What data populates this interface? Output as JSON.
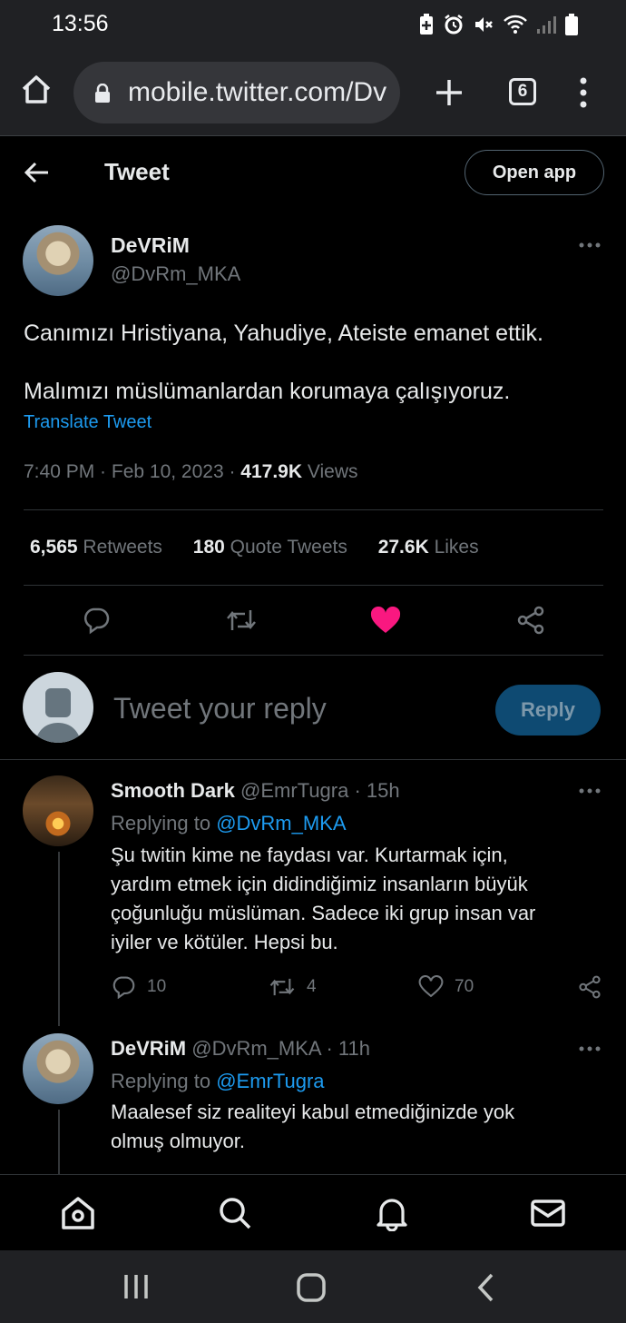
{
  "status_bar": {
    "time": "13:56"
  },
  "browser": {
    "url": "mobile.twitter.com/Dv",
    "tab_count": "6"
  },
  "header": {
    "title": "Tweet",
    "open_app": "Open app"
  },
  "tweet": {
    "author_name": "DeVRiM",
    "author_handle": "@DvRm_MKA",
    "text_line1": "Canımızı Hristiyana, Yahudiye, Ateiste emanet ettik.",
    "text_line2": "Malımızı müslümanlardan korumaya çalışıyoruz.",
    "translate": "Translate Tweet",
    "time": "7:40 PM · Feb 10, 2023 · ",
    "views_count": "417.9K",
    "views_label": " Views",
    "retweets_count": "6,565",
    "retweets_label": " Retweets",
    "quotes_count": "180",
    "quotes_label": " Quote Tweets",
    "likes_count": "27.6K",
    "likes_label": " Likes",
    "like_color": "#f91880"
  },
  "composer": {
    "placeholder": "Tweet your reply",
    "reply_button": "Reply"
  },
  "replies": [
    {
      "name": "Smooth Dark",
      "handle": " @EmrTugra",
      "time": " · 15h",
      "replying_label": "Replying to ",
      "replying_to": "@DvRm_MKA",
      "lines": [
        "Şu twitin kime ne faydası var. Kurtarmak için,",
        "yardım etmek için didindiğimiz insanların büyük",
        "çoğunluğu  müslüman. Sadece iki grup insan var",
        "iyiler ve kötüler. Hepsi bu."
      ],
      "replies": "10",
      "retweets": "4",
      "likes": "70"
    },
    {
      "name": "DeVRiM",
      "handle": " @DvRm_MKA",
      "time": " · 11h",
      "replying_label": "Replying to ",
      "replying_to": "@EmrTugra",
      "lines": [
        "Maalesef siz realiteyi kabul etmediğinizde yok",
        "olmuş olmuyor."
      ]
    }
  ]
}
